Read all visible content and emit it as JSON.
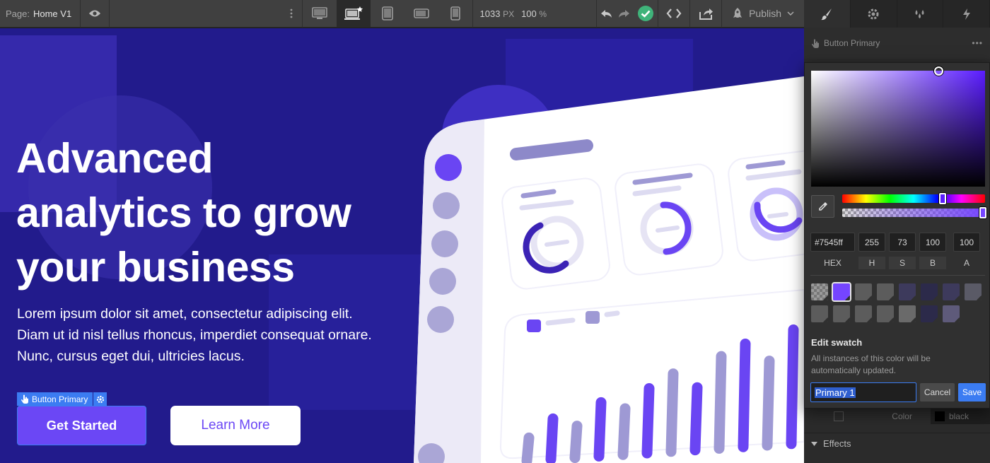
{
  "topbar": {
    "page_key": "Page:",
    "page_name": "Home V1",
    "viewport_width": "1033",
    "viewport_unit": "PX",
    "zoom": "100",
    "zoom_unit": "%",
    "publish_label": "Publish"
  },
  "canvas": {
    "title_lines": [
      "Advanced",
      "analytics to grow",
      "your business"
    ],
    "body_lines": [
      "Lorem ipsum dolor sit amet, consectetur adipiscing elit.",
      "Diam ut id nisl tellus rhoncus, imperdiet consequat ornare.",
      "Nunc, cursus eget dui, ultricies lacus."
    ],
    "selected_tag": "Button Primary",
    "primary_button": "Get Started",
    "secondary_button": "Learn More",
    "bar_chart_levels": [
      0.12,
      0.28,
      0.2,
      0.4,
      0.33,
      0.5,
      0.62,
      0.48,
      0.75,
      0.85,
      0.68,
      0.95,
      1.0
    ]
  },
  "right_panel": {
    "selected_element": "Button Primary",
    "color_label": "Color",
    "color_value": "black",
    "effects_label": "Effects"
  },
  "color_picker": {
    "hex": "#7545ff",
    "h": "255",
    "s": "73",
    "b": "100",
    "a": "100",
    "hex_label": "HEX",
    "h_label": "H",
    "s_label": "S",
    "b_label": "B",
    "a_label": "A",
    "swatches": [
      "#8a8a8a",
      "#7545ff",
      "#5c5c5c",
      "#5c5c5c",
      "#3d3a5c",
      "#2c2a4a",
      "#3d3a5c",
      "#5a5a66",
      "#5c5c5c",
      "#5c5c5c",
      "#5c5c5c",
      "#5c5c5c",
      "#6a6a6a",
      "#2c2a4a",
      "#5e5a7a"
    ],
    "edit_title": "Edit swatch",
    "edit_desc": "All instances of this color will be automatically updated.",
    "swatch_name": "Primary 1",
    "cancel_label": "Cancel",
    "save_label": "Save"
  }
}
